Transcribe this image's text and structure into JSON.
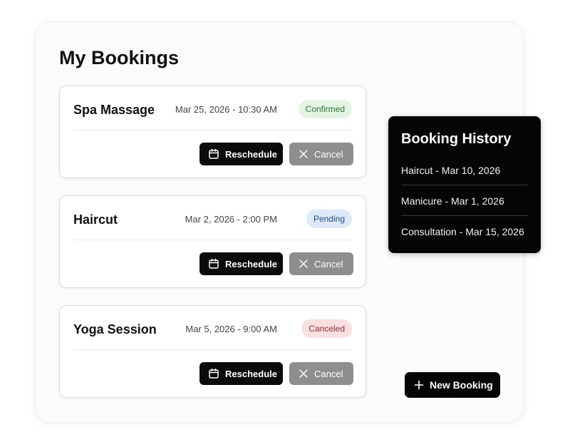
{
  "page": {
    "title": "My Bookings"
  },
  "bookings": [
    {
      "service": "Spa Massage",
      "datetime": "Mar 25, 2026 - 10:30 AM",
      "status": "Confirmed",
      "reschedule_label": "Reschedule",
      "cancel_label": "Cancel"
    },
    {
      "service": "Haircut",
      "datetime": "Mar 2, 2026 - 2:00 PM",
      "status": "Pending",
      "reschedule_label": "Reschedule",
      "cancel_label": "Cancel"
    },
    {
      "service": "Yoga Session",
      "datetime": "Mar 5, 2026 - 9:00 AM",
      "status": "Canceled",
      "reschedule_label": "Reschedule",
      "cancel_label": "Cancel"
    }
  ],
  "history": {
    "title": "Booking History",
    "items": [
      "Haircut - Mar 10, 2026",
      "Manicure - Mar 1, 2026",
      "Consultation - Mar 15, 2026"
    ]
  },
  "actions": {
    "new_booking_label": "New Booking"
  },
  "icons": {
    "reschedule": "calendar-icon",
    "cancel": "close-icon",
    "new_booking": "plus-icon"
  },
  "colors": {
    "primary_button": "#0b0b0b",
    "cancel_button": "#8e8e8e",
    "confirmed_badge_bg": "#e3f3e4",
    "confirmed_badge_text": "#2b7a34",
    "pending_badge_bg": "#dde9f8",
    "pending_badge_text": "#1e4d8c",
    "canceled_badge_bg": "#f8dfe0",
    "canceled_badge_text": "#9a2a2f",
    "history_panel_bg": "#050505"
  }
}
